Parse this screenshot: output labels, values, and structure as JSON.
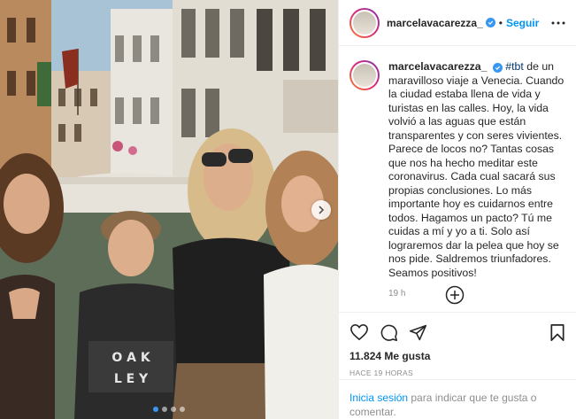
{
  "header": {
    "username": "marcelavacarezza_",
    "separator": "•",
    "follow_label": "Seguir",
    "more_icon": "more-horizontal-icon",
    "verified_icon": "verified-badge-icon"
  },
  "caption": {
    "username": "marcelavacarezza_",
    "hashtag": "#tbt",
    "text": " de un maravilloso viaje a Venecia. Cuando la ciudad estaba llena de vida y turistas en las calles. Hoy, la vida volvió a las aguas que están transparentes y con seres vivientes. Parece de locos no? Tantas cosas que nos ha hecho meditar este coronavirus. Cada cual sacará sus propias conclusiones. Lo más importante hoy es cuidarnos entre todos. Hagamos un pacto? Tú me cuidas a mí y yo a ti. Solo así lograremos dar la pelea que hoy se nos pide. Saldremos triunfadores. Seamos positivos!",
    "time": "19 h"
  },
  "actions": {
    "like_icon": "heart-icon",
    "comment_icon": "comment-icon",
    "share_icon": "paper-plane-icon",
    "save_icon": "bookmark-icon",
    "load_more_icon": "plus-circle-icon"
  },
  "likes": "11.824 Me gusta",
  "posted_ago": "HACE 19 HORAS",
  "login": {
    "link_label": "Inicia sesión",
    "rest_text": " para indicar que te gusta o comentar."
  },
  "photo": {
    "shirt_text_line1": "O A K",
    "shirt_text_line2": "L E Y",
    "carousel_dots": 4,
    "active_dot": 1,
    "accent_color": "#0095f6"
  }
}
